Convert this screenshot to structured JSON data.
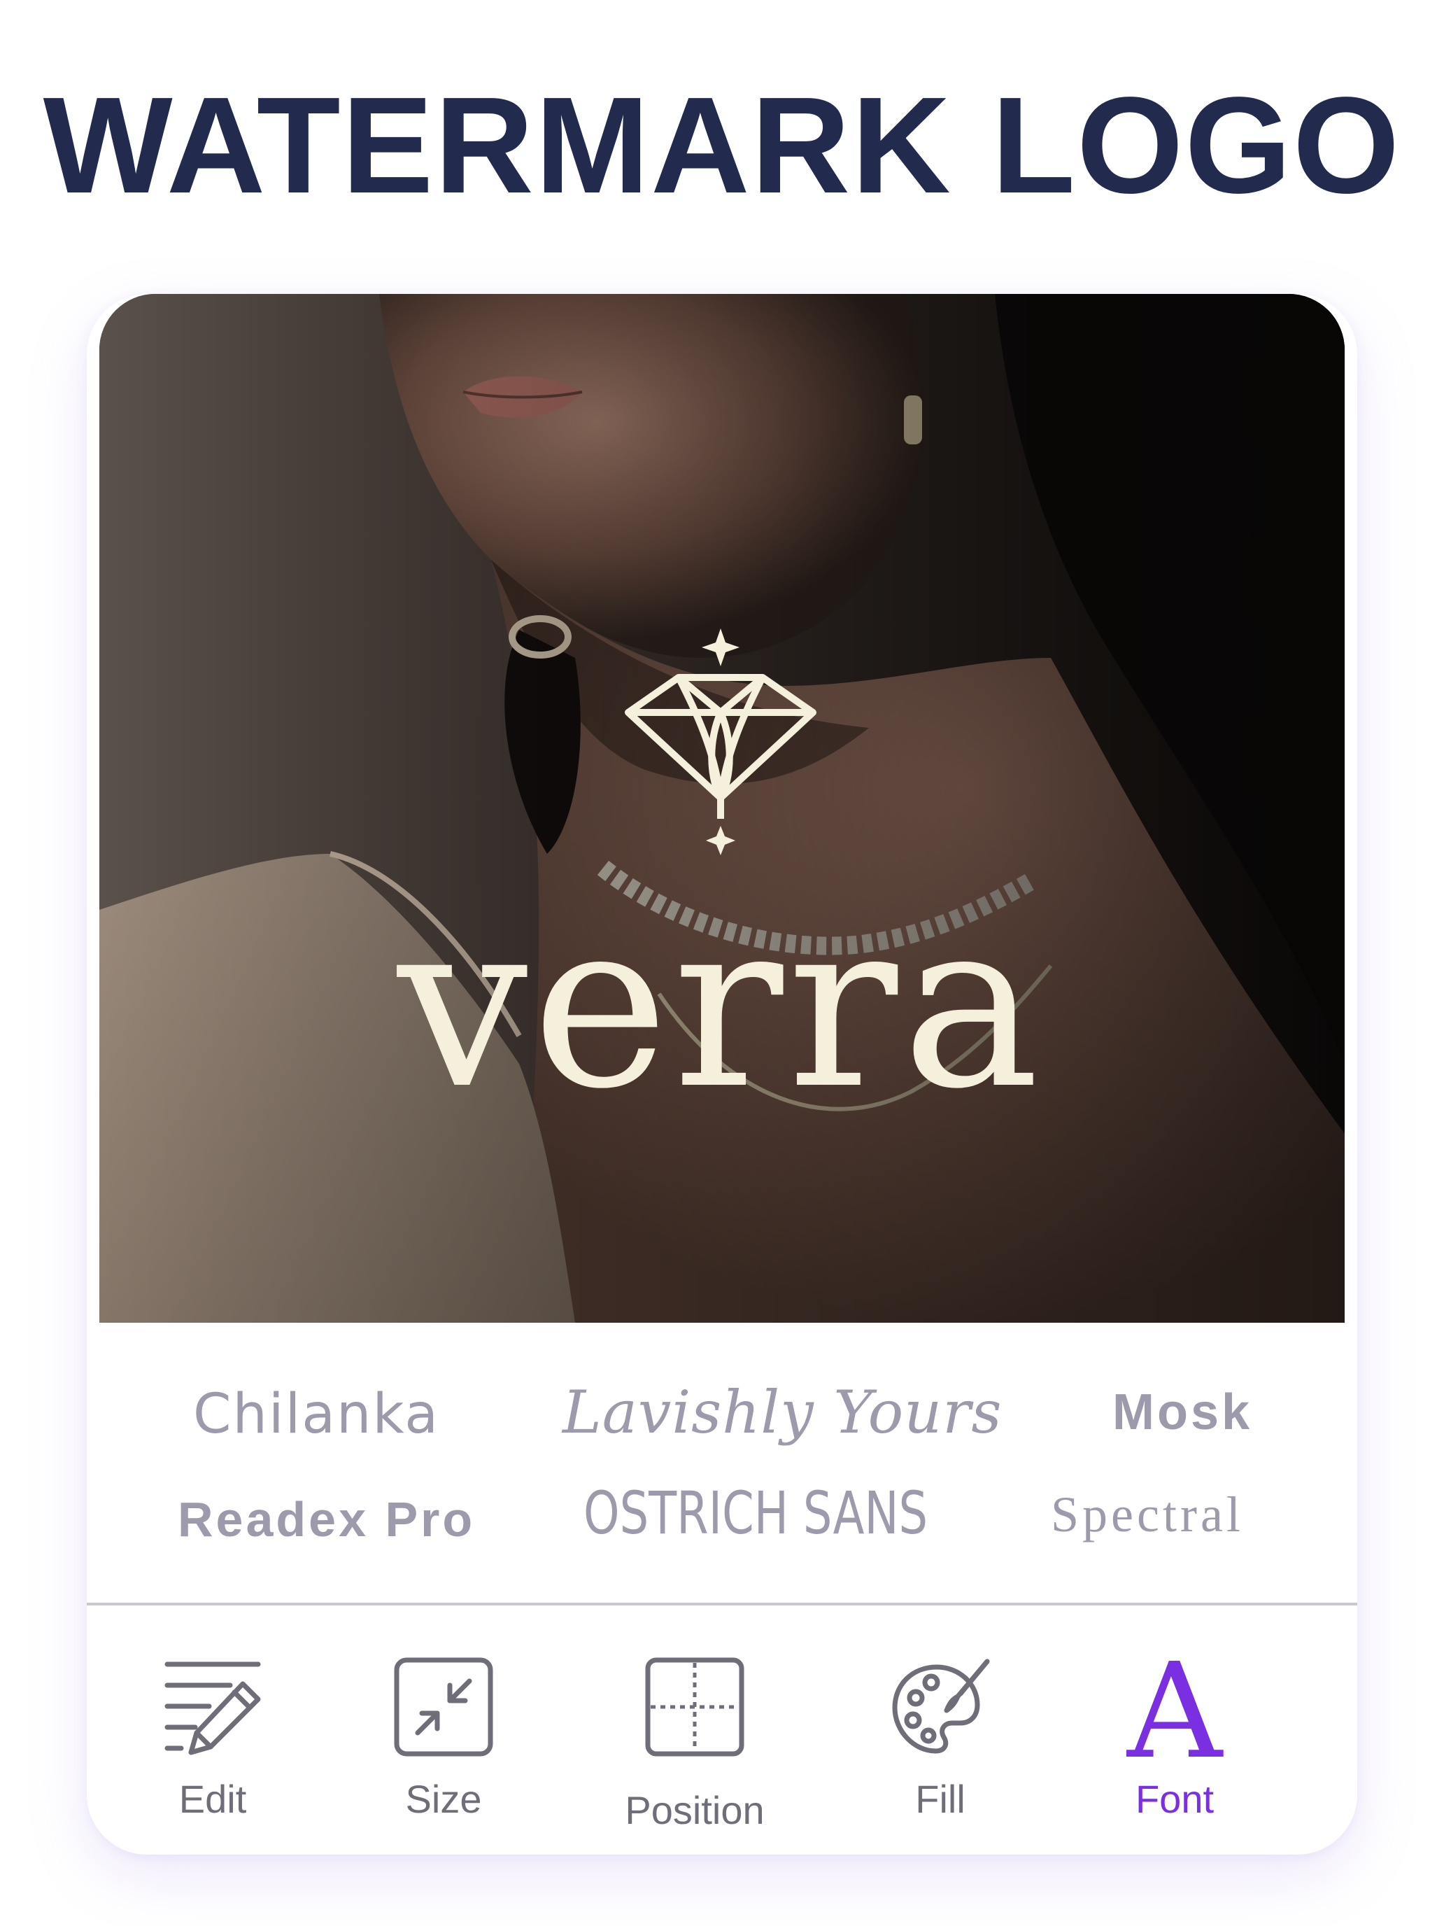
{
  "headline": {
    "bold": "WATERMARK",
    "light": "LOGO"
  },
  "logo": {
    "wordmark": "verra",
    "icon": "diamond-logo-icon",
    "color": "#f5f0dc"
  },
  "fonts": [
    {
      "label": "Chilanka"
    },
    {
      "label": "Lavishly Yours"
    },
    {
      "label": "Mosk"
    },
    {
      "label": "Readex Pro"
    },
    {
      "label": "OSTRICH SANS"
    },
    {
      "label": "Spectral"
    }
  ],
  "toolbar": {
    "edit": {
      "label": "Edit",
      "icon": "edit-pencil-icon"
    },
    "size": {
      "label": "Size",
      "icon": "shrink-arrows-icon"
    },
    "position": {
      "label": "Position",
      "icon": "position-grid-icon"
    },
    "fill": {
      "label": "Fill",
      "icon": "palette-icon"
    },
    "font": {
      "label": "Font",
      "icon": "font-a-icon",
      "glyph": "A",
      "active": true
    }
  },
  "colors": {
    "headline": "#222a4d",
    "accent": "#7a2fe0",
    "inactive": "#6f6d78",
    "font_option": "#9d9aac"
  }
}
